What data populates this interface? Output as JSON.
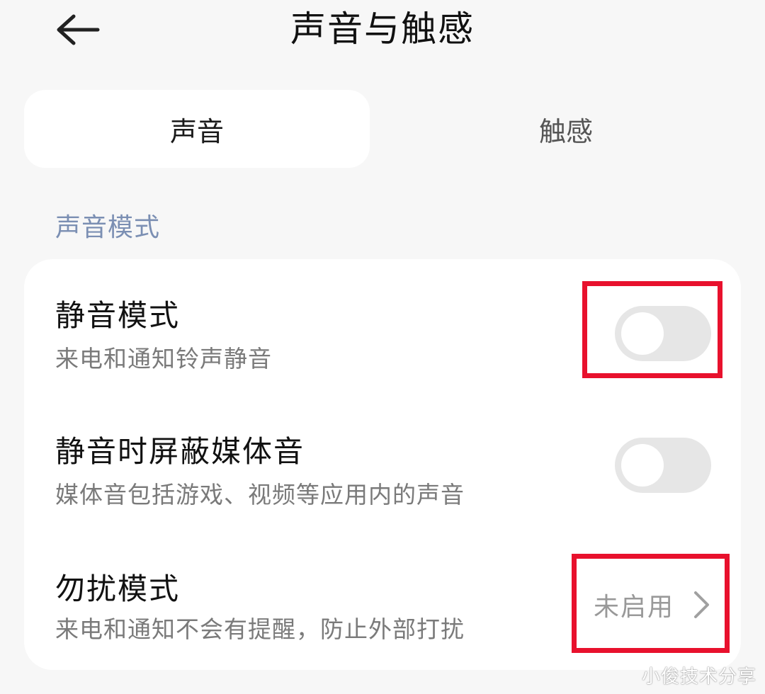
{
  "header": {
    "title": "声音与触感"
  },
  "tabs": [
    {
      "label": "声音",
      "selected": true
    },
    {
      "label": "触感",
      "selected": false
    }
  ],
  "section": {
    "label": "声音模式"
  },
  "settings": [
    {
      "title": "静音模式",
      "subtitle": "来电和通知铃声静音",
      "control": "toggle",
      "enabled": false
    },
    {
      "title": "静音时屏蔽媒体音",
      "subtitle": "媒体音包括游戏、视频等应用内的声音",
      "control": "toggle",
      "enabled": false
    },
    {
      "title": "勿扰模式",
      "subtitle": "来电和通知不会有提醒，防止外部打扰",
      "control": "link",
      "value": "未启用"
    }
  ],
  "watermark": "小俊技术分享",
  "colors": {
    "background": "#f7f7f7",
    "card": "#ffffff",
    "section_label": "#7b8fb3",
    "toggle_off": "#e6e6e6",
    "highlight": "#e8112d"
  },
  "icons": {
    "back": "arrow-left-icon",
    "chevron": "chevron-right-icon"
  }
}
